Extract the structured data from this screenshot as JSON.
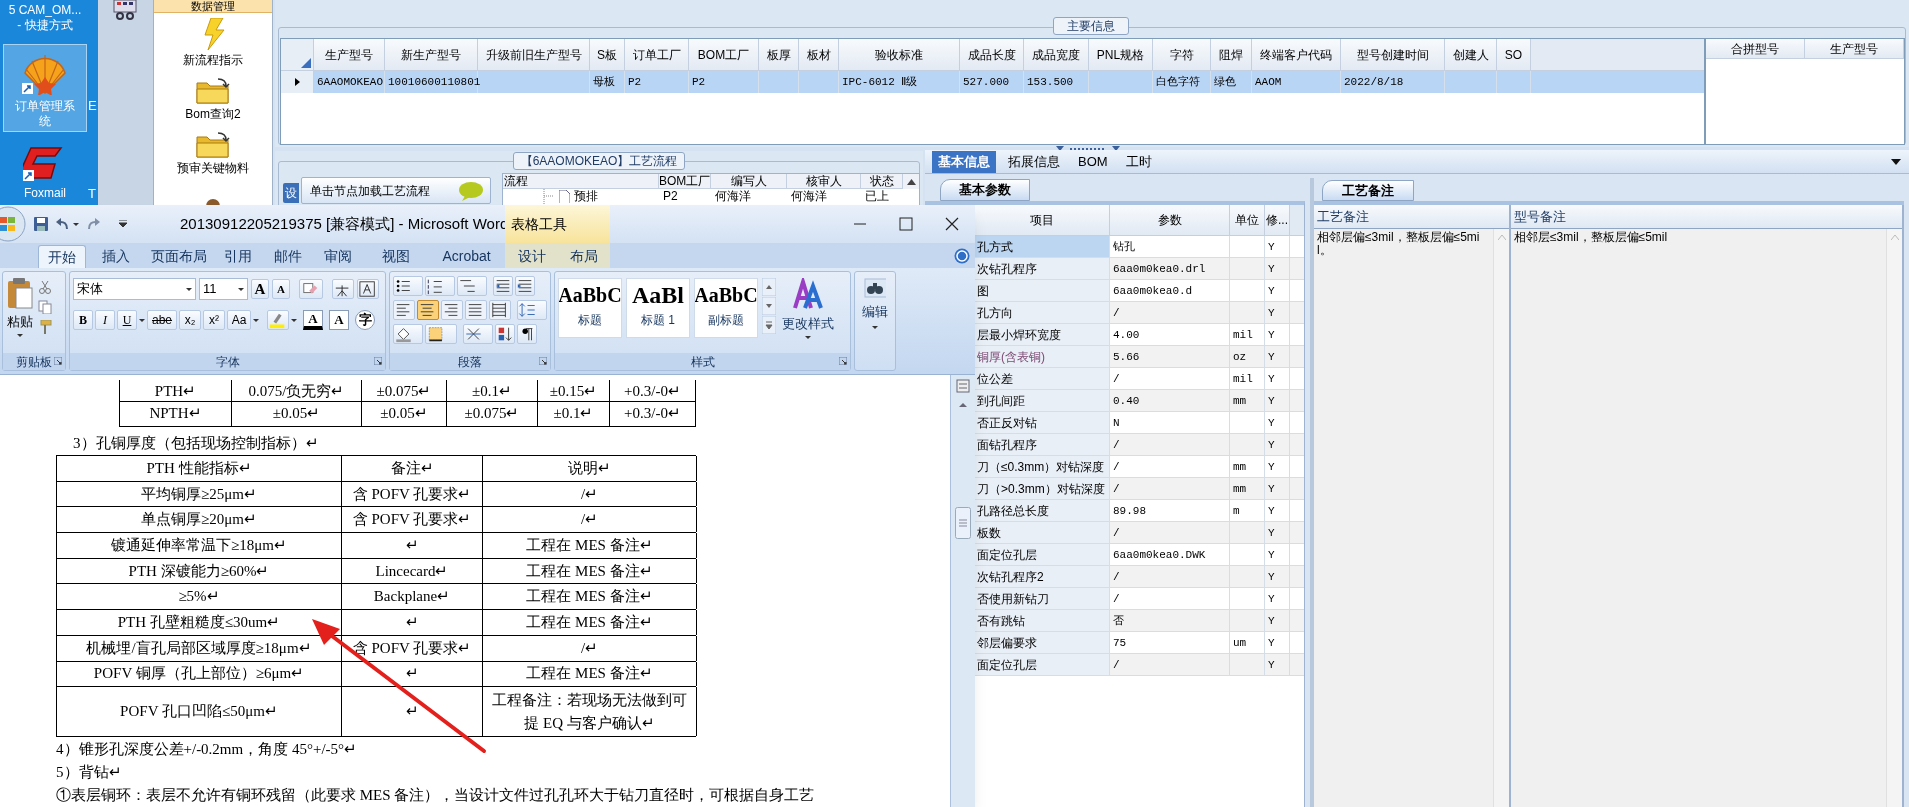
{
  "desktop": {
    "icons": [
      {
        "kind": "cut",
        "lines": [
          "5  CAM_OM...",
          "- 快捷方式"
        ],
        "selected": false
      },
      {
        "kind": "shell",
        "lines": [
          "订单管理系",
          "统"
        ],
        "selected": true
      },
      {
        "kind": "mail",
        "lines": [
          "Foxmail"
        ],
        "selected": false
      }
    ],
    "clipped_labels": [
      "E",
      "T"
    ]
  },
  "nav": {
    "header": "数据管理",
    "items": [
      {
        "kind": "lightning",
        "label": "新流程指示"
      },
      {
        "kind": "folder",
        "label": "Bom查询2"
      },
      {
        "kind": "folder",
        "label": "预审关键物料"
      },
      {
        "kind": "person"
      }
    ]
  },
  "main_info": {
    "title": "主要信息",
    "columns": [
      "生产型号",
      "新生产型号",
      "升级前旧生产型号",
      "S板",
      "订单工厂",
      "BOM工厂",
      "板厚",
      "板材",
      "验收标准",
      "成品长度",
      "成品宽度",
      "PNL规格",
      "字符",
      "阻焊",
      "终端客户代码",
      "型号创建时间",
      "创建人",
      "SO"
    ],
    "rows": [
      {
        "selected": true,
        "cells": [
          "6AAOMOKEAO",
          "10010600110801",
          null,
          "母板",
          "P2",
          "P2",
          null,
          null,
          "IPC-6012 Ⅱ级",
          "527.000",
          "153.500",
          null,
          "白色字符",
          "绿色",
          "AAOM",
          "2022/8/18",
          null,
          null
        ]
      }
    ],
    "side_columns": [
      "合拼型号",
      "生产型号"
    ]
  },
  "process_panel": {
    "title": "【6AAOMOKEAO】工艺流程",
    "side_tab": "设",
    "load_button": "单击节点加载工艺流程",
    "columns": [
      "流程",
      "BOM工厂",
      "编写人",
      "核审人",
      "状态"
    ],
    "rows": [
      {
        "cells": [
          "预排",
          "P2",
          "何海洋",
          "何海洋",
          "已上"
        ]
      }
    ]
  },
  "detail_tabs": [
    {
      "label": "基本信息",
      "selected": true
    },
    {
      "label": "拓展信息",
      "selected": false
    },
    {
      "label": "BOM",
      "selected": false
    },
    {
      "label": "工时",
      "selected": false
    }
  ],
  "basic_params": {
    "tab": "基本参数",
    "columns": [
      "项目",
      "参数",
      "单位",
      "修..."
    ],
    "rows": [
      {
        "item": "孔方式",
        "value": "钻孔",
        "flag": "Y",
        "selected": true
      },
      {
        "item": "次钻孔程序",
        "value": "6aa0m0kea0.drl",
        "flag": "Y",
        "selected": false
      },
      {
        "item": "图",
        "value": "6aa0m0kea0.d",
        "flag": "Y",
        "selected": false
      },
      {
        "item": "孔方向",
        "value": "/",
        "flag": "Y",
        "selected": false
      },
      {
        "item": "层最小焊环宽度",
        "value": "4.00",
        "unit": "mil",
        "flag": "Y",
        "selected": false
      },
      {
        "item": "铜厚(含表铜)",
        "value": "5.66",
        "unit": "oz",
        "flag": "Y",
        "selected": false,
        "color": "#7d4b73"
      },
      {
        "item": "位公差",
        "value": "/",
        "unit": "mil",
        "flag": "Y",
        "selected": false
      },
      {
        "item": "到孔间距",
        "value": "0.40",
        "unit": "mm",
        "flag": "Y",
        "selected": false
      },
      {
        "item": "否正反对钻",
        "value": "N",
        "flag": "Y",
        "selected": false
      },
      {
        "item": "面钻孔程序",
        "value": "/",
        "flag": "Y",
        "selected": false
      },
      {
        "item": "刀（≤0.3mm）对钻深度",
        "value": "/",
        "unit": "mm",
        "flag": "Y",
        "selected": false
      },
      {
        "item": "刀（>0.3mm）对钻深度",
        "value": "/",
        "unit": "mm",
        "flag": "Y",
        "selected": false
      },
      {
        "item": "孔路径总长度",
        "value": "89.98",
        "unit": "m",
        "flag": "Y",
        "selected": false
      },
      {
        "item": "板数",
        "value": "/",
        "flag": "Y",
        "selected": false
      },
      {
        "item": "面定位孔层",
        "value": "6aa0m0kea0.DWK",
        "flag": "Y",
        "selected": false
      },
      {
        "item": "次钻孔程序2",
        "value": "/",
        "flag": "Y",
        "selected": false
      },
      {
        "item": "否使用新钻刀",
        "value": "/",
        "flag": "Y",
        "selected": false
      },
      {
        "item": "否有跳钻",
        "value": "否",
        "flag": "Y",
        "selected": false
      },
      {
        "item": "邻层偏要求",
        "value": "75",
        "unit": "um",
        "flag": "Y",
        "selected": false
      },
      {
        "item": "面定位孔层",
        "value": "/",
        "flag": "Y",
        "selected": false
      }
    ]
  },
  "process_notes": {
    "tab": "工艺备注",
    "columns": [
      "工艺备注",
      "型号备注"
    ],
    "values": [
      "相邻层偏≤3mil，整板层偏≤5mil。",
      "相邻层≤3mil，整板层偏≤5mil"
    ]
  },
  "word": {
    "title": "20130912205219375 [兼容模式] - Microsoft Word",
    "tabs": [
      {
        "label": "开始",
        "selected": true
      },
      {
        "label": "插入",
        "selected": false
      },
      {
        "label": "页面布局",
        "selected": false
      },
      {
        "label": "引用",
        "selected": false
      },
      {
        "label": "邮件",
        "selected": false
      },
      {
        "label": "审阅",
        "selected": false
      },
      {
        "label": "视图",
        "selected": false
      },
      {
        "label": "Acrobat",
        "selected": false
      }
    ],
    "context_tools": {
      "label": "表格工具",
      "tabs": [
        {
          "label": "设计",
          "selected": false
        },
        {
          "label": "布局",
          "selected": false
        }
      ]
    },
    "paste": "粘贴",
    "font_name": "宋体",
    "font_size": "11",
    "font_size_buttons": [
      "A",
      "A"
    ],
    "font_format_buttons": [
      "B",
      "I",
      "U",
      "abe",
      "x₂",
      "x²",
      "Aa"
    ],
    "font_effect_buttons": [
      "A",
      "A",
      "字"
    ],
    "alignment_buttons": [
      {
        "selected": false
      },
      {
        "selected": true
      },
      {
        "selected": false
      },
      {
        "selected": false
      },
      {
        "selected": false
      }
    ],
    "styles": [
      {
        "sample": "AaBbC",
        "caption": "标题"
      },
      {
        "sample": "AaBl",
        "caption": "标题 1"
      },
      {
        "sample": "AaBbC",
        "caption": "副标题"
      }
    ],
    "change_styles": "更改样式",
    "edit": "编辑",
    "group_labels": [
      "剪贴板",
      "字体",
      "段落",
      "样式"
    ]
  },
  "document": {
    "top_table": [
      [
        "PTH↵",
        "0.075/负无穷↵",
        "±0.075↵",
        "±0.1↵",
        "±0.15↵",
        "+0.3/-0↵"
      ],
      [
        "NPTH↵",
        "±0.05↵",
        "±0.05↵",
        "±0.075↵",
        "±0.1↵",
        "+0.3/-0↵"
      ]
    ],
    "heading": "3）孔铜厚度（包括现场控制指标）↵",
    "table_header": [
      "PTH 性能指标↵",
      "备注↵",
      "说明↵"
    ],
    "table_rows": [
      [
        "平均铜厚≥25μm↵",
        "含 POFV 孔要求↵",
        "/↵"
      ],
      [
        "单点铜厚≥20μm↵",
        "含 POFV 孔要求↵",
        "/↵"
      ],
      [
        "镀通延伸率常温下≥18μm↵",
        "↵",
        "工程在 MES 备注↵"
      ],
      [
        "PTH 深镀能力≥60%↵",
        "Lincecard↵",
        "工程在 MES 备注↵"
      ],
      [
        "≥5%↵",
        "Backplane↵",
        "工程在 MES 备注↵"
      ],
      [
        "PTH 孔壁粗糙度≤30um↵",
        "↵",
        "工程在 MES 备注↵"
      ],
      [
        "机械埋/盲孔局部区域厚度≥18μm↵",
        "含 POFV 孔要求↵",
        "/↵"
      ],
      [
        "POFV 铜厚（孔上部位）≥6μm↵",
        "↵",
        "工程在 MES 备注↵"
      ],
      [
        "POFV 孔口凹陷≤50μm↵",
        "↵",
        "工程备注：若现场无法做到可提 EQ 与客户确认↵"
      ]
    ],
    "paragraphs": [
      "4）锥形孔深度公差+/-0.2mm，角度 45°+/-5°↵",
      "5）背钻↵",
      "①表层铜环：表层不允许有铜环残留（此要求 MES 备注），当设计文件过孔孔环大于钻刀直径时，可根据自身工艺"
    ]
  }
}
